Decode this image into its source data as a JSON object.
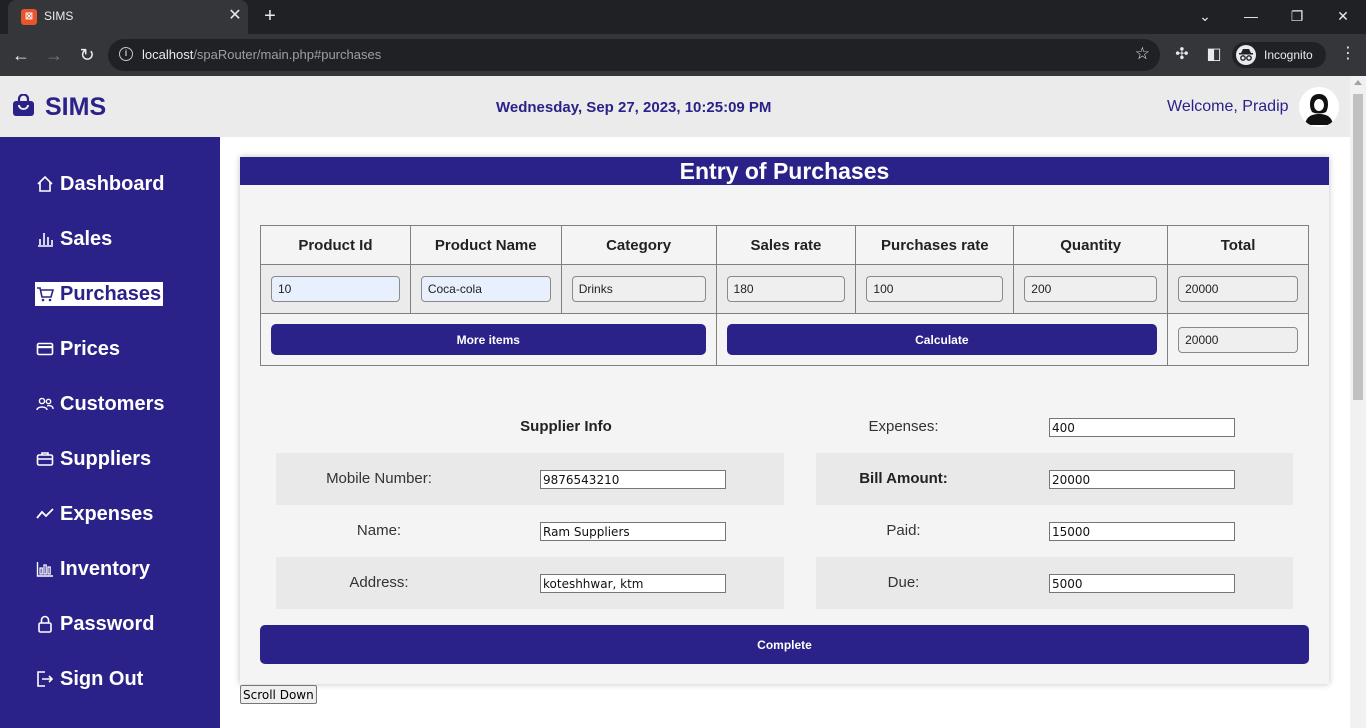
{
  "browser": {
    "tab_title": "SIMS",
    "url_host": "localhost",
    "url_path": "/spaRouter/main.php#purchases",
    "profile_label": "Incognito"
  },
  "header": {
    "brand": "SIMS",
    "datetime": "Wednesday, Sep 27, 2023, 10:25:09 PM",
    "welcome": "Welcome, Pradip"
  },
  "sidebar": {
    "items": [
      {
        "label": "Dashboard",
        "icon": "home-icon"
      },
      {
        "label": "Sales",
        "icon": "bar-chart-icon"
      },
      {
        "label": "Purchases",
        "icon": "cart-icon",
        "active": true
      },
      {
        "label": "Prices",
        "icon": "credit-card-icon"
      },
      {
        "label": "Customers",
        "icon": "people-icon"
      },
      {
        "label": "Suppliers",
        "icon": "briefcase-icon"
      },
      {
        "label": "Expenses",
        "icon": "trend-icon"
      },
      {
        "label": "Inventory",
        "icon": "chart-icon"
      },
      {
        "label": "Password",
        "icon": "lock-icon"
      },
      {
        "label": "Sign Out",
        "icon": "sign-out-icon"
      }
    ]
  },
  "form": {
    "title": "Entry of Purchases",
    "columns": [
      "Product Id",
      "Product Name",
      "Category",
      "Sales rate",
      "Purchases rate",
      "Quantity",
      "Total"
    ],
    "row": {
      "product_id": "10",
      "product_name": "Coca-cola",
      "category": "Drinks",
      "sales_rate": "180",
      "purchases_rate": "100",
      "quantity": "200",
      "total": "20000"
    },
    "more_items_label": "More items",
    "calculate_label": "Calculate",
    "grand_total": "20000",
    "supplier": {
      "heading": "Supplier Info",
      "mobile_label": "Mobile Number:",
      "mobile_value": "9876543210",
      "name_label": "Name:",
      "name_value": "Ram Suppliers",
      "address_label": "Address:",
      "address_value": "koteshhwar, ktm"
    },
    "billing": {
      "expenses_label": "Expenses:",
      "expenses_value": "400",
      "bill_label": "Bill Amount:",
      "bill_value": "20000",
      "paid_label": "Paid:",
      "paid_value": "15000",
      "due_label": "Due:",
      "due_value": "5000"
    },
    "complete_label": "Complete"
  },
  "scroll_down_label": "Scroll Down",
  "colors": {
    "brand": "#2a2288",
    "header_bg": "#ecebec",
    "card_bg": "#f4f4f4"
  }
}
